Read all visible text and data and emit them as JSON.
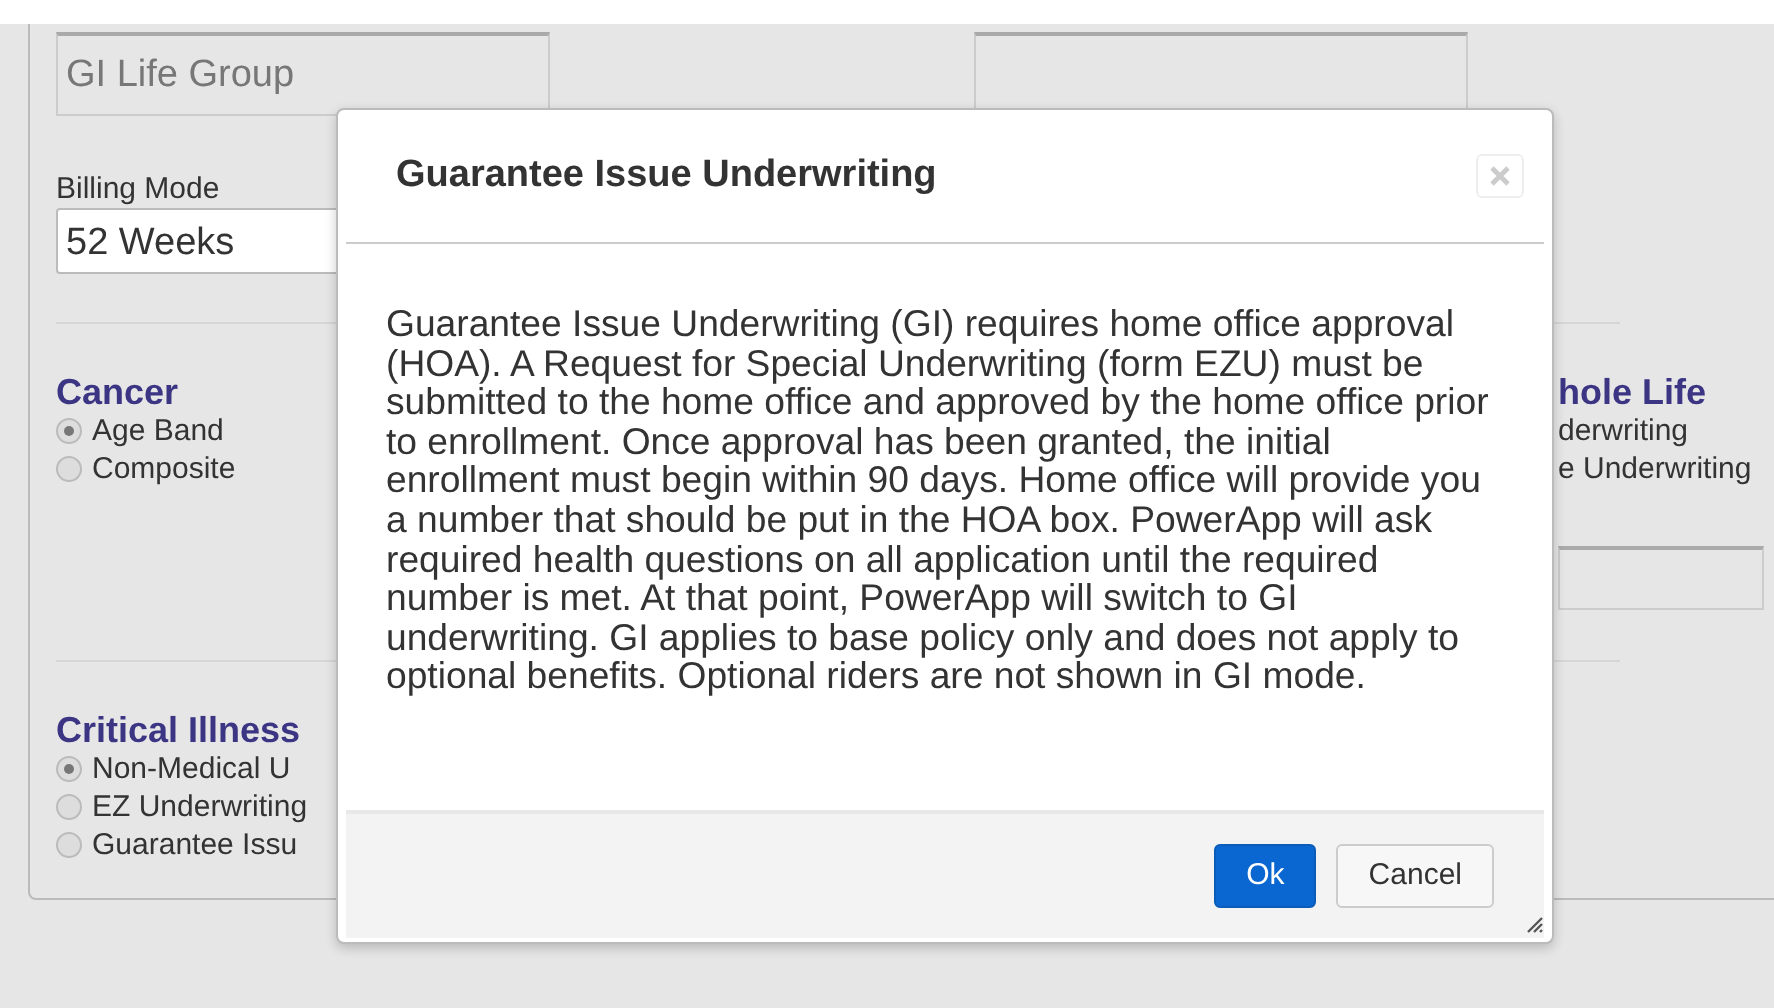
{
  "form": {
    "fields": [
      {
        "value": "GI Life Group",
        "disabled": true
      },
      {
        "disabled": true
      }
    ],
    "billing_mode": {
      "label": "Billing Mode",
      "value": "52 Weeks"
    },
    "sections": [
      {
        "title": "Cancer",
        "options": [
          {
            "label": "Age Band",
            "selected": true
          },
          {
            "label": "Composite",
            "selected": false
          }
        ]
      },
      {
        "title": "Critical Illness",
        "options": [
          {
            "label": "Non-Medical U",
            "selected": true
          },
          {
            "label": "EZ Underwriting",
            "selected": false
          },
          {
            "label": "Guarantee Issu",
            "selected": false
          }
        ]
      }
    ],
    "side_section": {
      "title": "hole Life",
      "lines": [
        "derwriting",
        "e Underwriting"
      ]
    }
  },
  "dialog": {
    "title": "Guarantee Issue Underwriting",
    "body": "Guarantee Issue Underwriting (GI) requires home office approval (HOA). A Request for Special Underwriting (form EZU) must be submitted to the home office and approved by the home office prior to enrollment. Once approval has been granted, the initial enrollment must begin within 90 days. Home office will provide you a number that should be put in the HOA box. PowerApp will ask required health questions on all application until the required number is met. At that point, PowerApp will switch to GI underwriting. GI applies to base policy only and does not apply to optional benefits. Optional riders are not shown in GI mode.",
    "buttons": [
      {
        "label": "Ok",
        "primary": true
      },
      {
        "label": "Cancel",
        "primary": false
      }
    ]
  }
}
